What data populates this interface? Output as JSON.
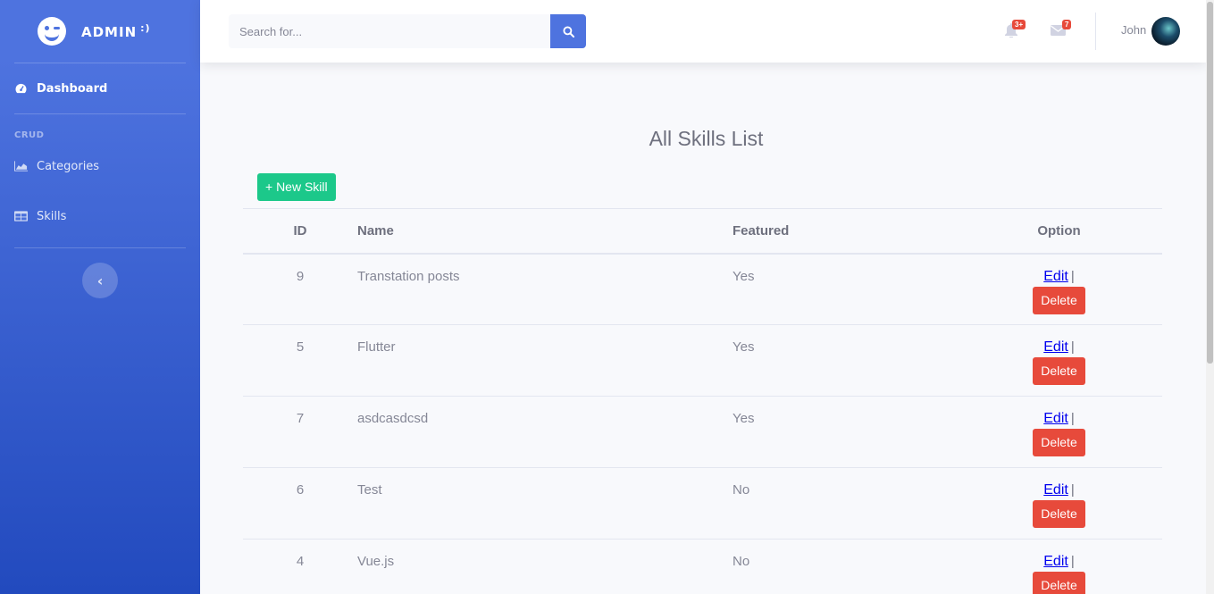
{
  "sidebar": {
    "brand": "ADMIN",
    "brand_suffix": ":)",
    "dashboard": "Dashboard",
    "heading": "CRUD",
    "items": [
      {
        "label": "Categories",
        "icon": "chart-area-icon"
      },
      {
        "label": "Skills",
        "icon": "table-icon"
      }
    ],
    "toggle": "‹"
  },
  "topbar": {
    "search_placeholder": "Search for...",
    "alerts_badge": "3+",
    "messages_badge": "7",
    "user_name": "John"
  },
  "main": {
    "title": "All Skills List",
    "new_button": "+ New Skill",
    "columns": [
      "ID",
      "Name",
      "Featured",
      "Option"
    ],
    "rows": [
      {
        "id": "9",
        "name": "Transtation posts",
        "featured": "Yes"
      },
      {
        "id": "5",
        "name": "Flutter",
        "featured": "Yes"
      },
      {
        "id": "7",
        "name": "asdcasdcsd",
        "featured": "Yes"
      },
      {
        "id": "6",
        "name": "Test",
        "featured": "No"
      },
      {
        "id": "4",
        "name": "Vue.js",
        "featured": "No"
      }
    ],
    "edit_label": "Edit",
    "separator": "|",
    "delete_label": "Delete"
  },
  "colors": {
    "primary": "#4e73df",
    "success": "#1cc88a",
    "danger": "#e74a3b"
  }
}
